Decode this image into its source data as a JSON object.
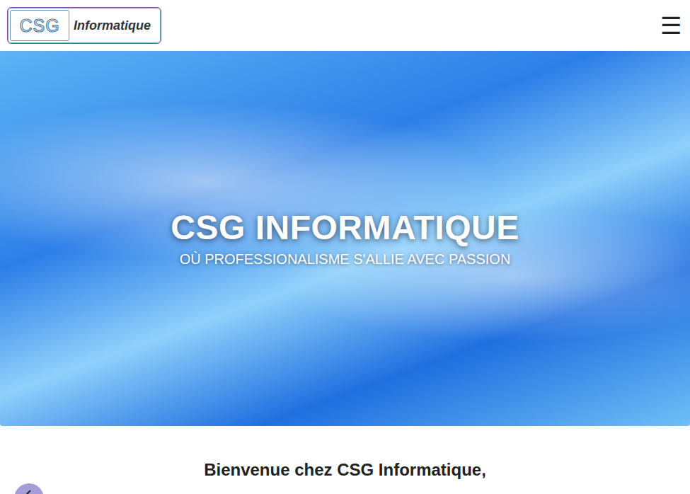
{
  "header": {
    "logo": {
      "mark": "CSG",
      "name": "Informatique"
    },
    "menu_button": "☰"
  },
  "hero": {
    "title": "CSG INFORMATIQUE",
    "subtitle": "OÙ PROFESSIONALISME S'ALLIE AVEC PASSION"
  },
  "welcome": {
    "heading": "Bienvenue chez CSG Informatique,"
  }
}
